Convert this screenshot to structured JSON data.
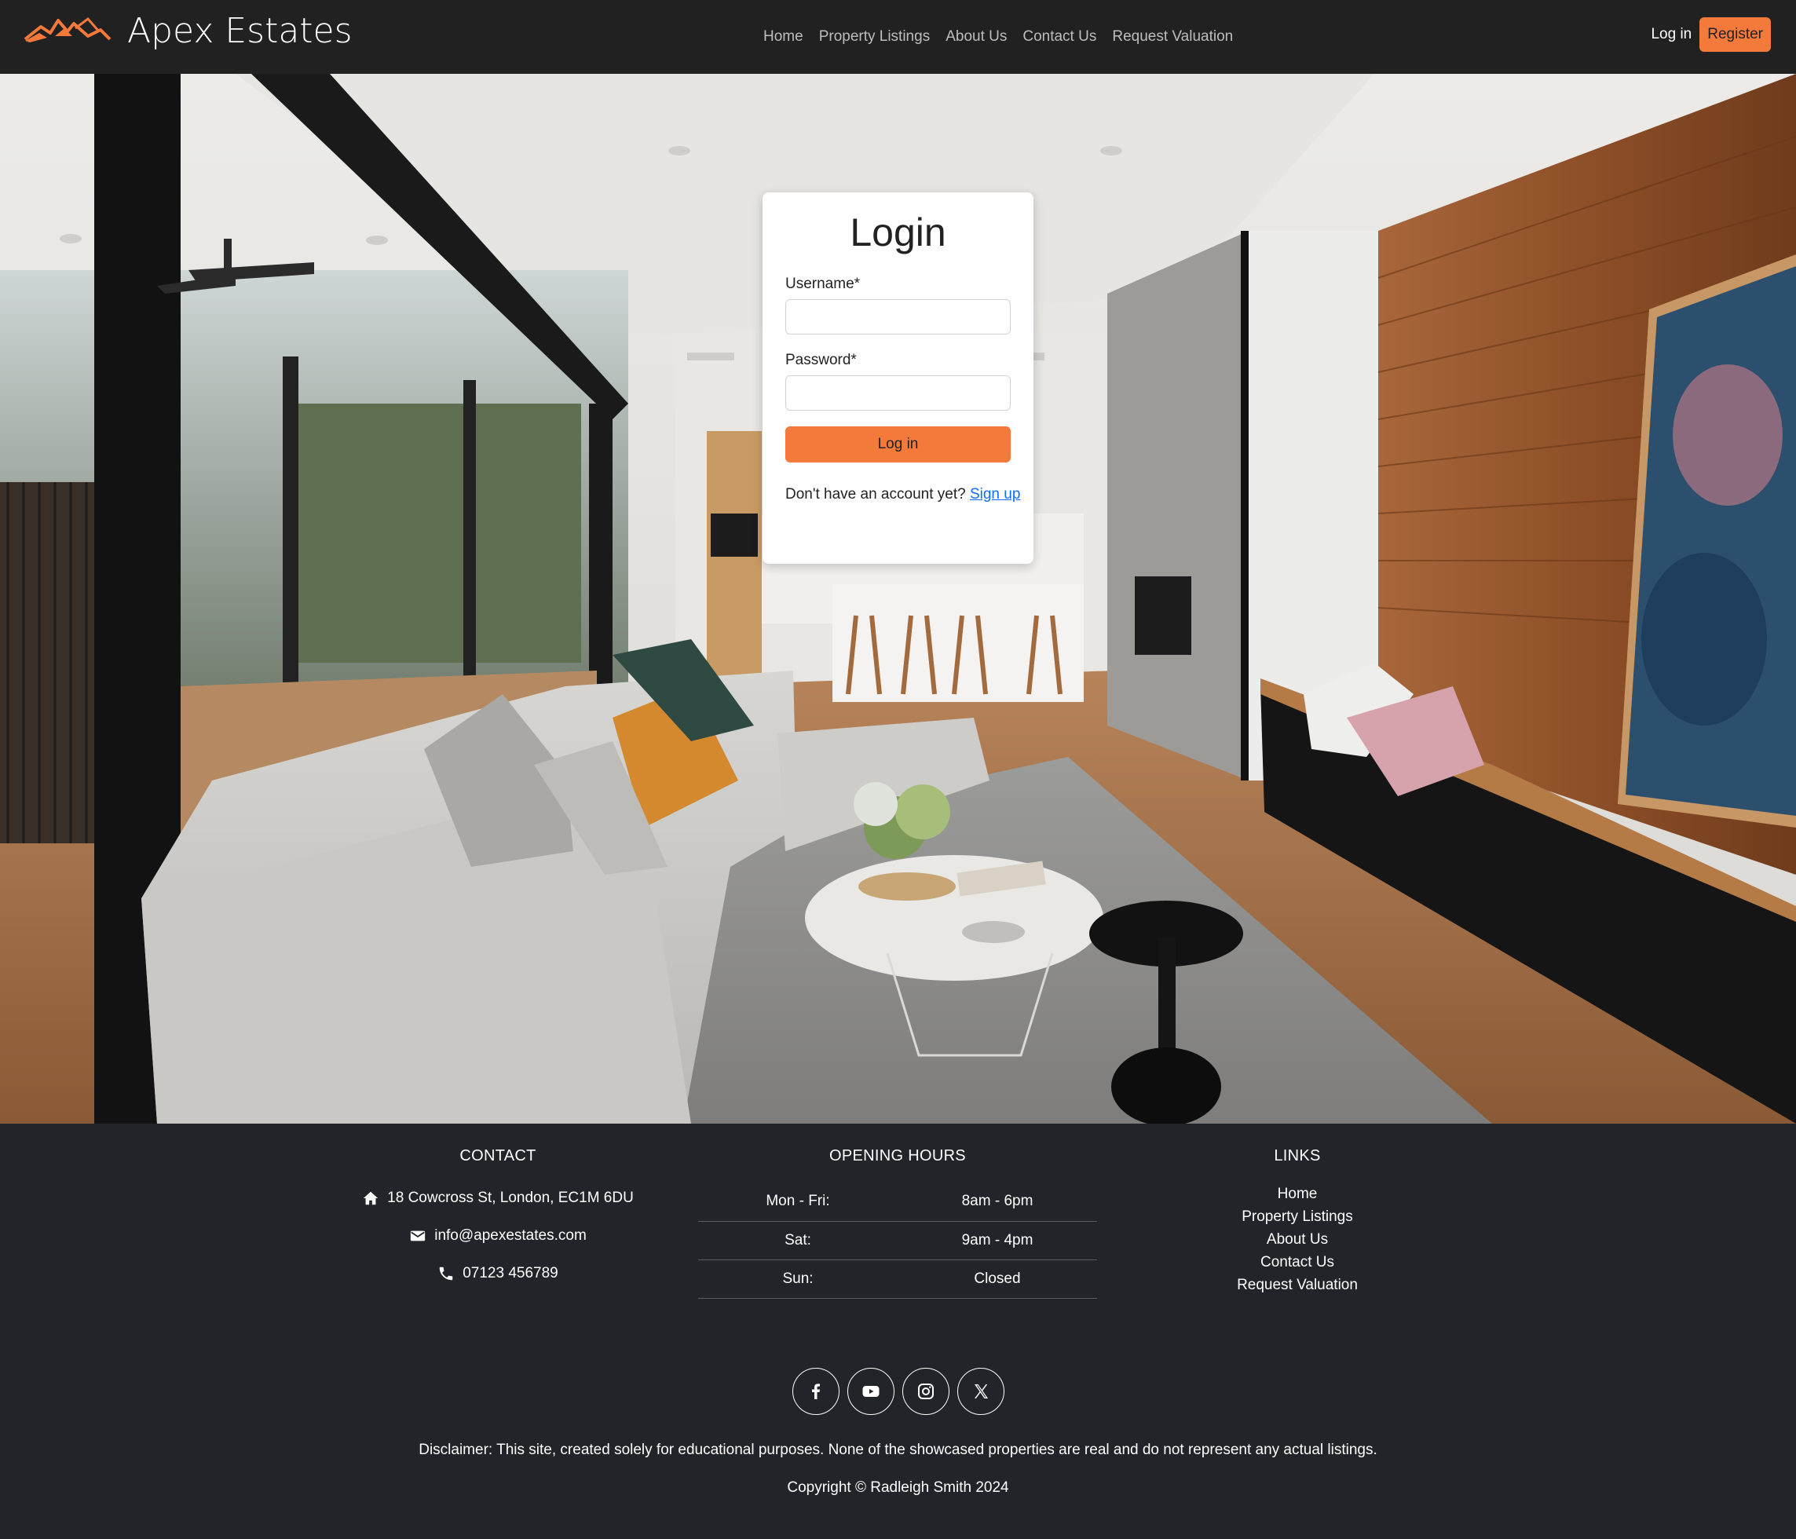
{
  "brand": {
    "name": "Apex Estates",
    "logo_icon": "mountain-logo-icon",
    "accent": "#f47a3b"
  },
  "nav": {
    "links": [
      "Home",
      "Property Listings",
      "About Us",
      "Contact Us",
      "Request Valuation"
    ],
    "login_label": "Log in",
    "register_label": "Register"
  },
  "login": {
    "title": "Login",
    "username_label": "Username*",
    "username_value": "",
    "password_label": "Password*",
    "password_value": "",
    "submit_label": "Log in",
    "signup_prompt": "Don't have an account yet?",
    "signup_link": "Sign up"
  },
  "footer": {
    "contact": {
      "heading": "CONTACT",
      "address": "18 Cowcross St, London, EC1M 6DU",
      "email": "info@apexestates.com",
      "phone": "07123 456789"
    },
    "hours": {
      "heading": "OPENING HOURS",
      "rows": [
        {
          "day": "Mon - Fri:",
          "time": "8am - 6pm"
        },
        {
          "day": "Sat:",
          "time": "9am - 4pm"
        },
        {
          "day": "Sun:",
          "time": "Closed"
        }
      ]
    },
    "links": {
      "heading": "LINKS",
      "items": [
        "Home",
        "Property Listings",
        "About Us",
        "Contact Us",
        "Request Valuation"
      ]
    },
    "socials": [
      "facebook-icon",
      "youtube-icon",
      "instagram-icon",
      "x-twitter-icon"
    ],
    "disclaimer": "Disclaimer: This site, created solely for educational purposes. None of the showcased properties are real and do not represent any actual listings.",
    "copyright": "Copyright © Radleigh Smith 2024"
  }
}
